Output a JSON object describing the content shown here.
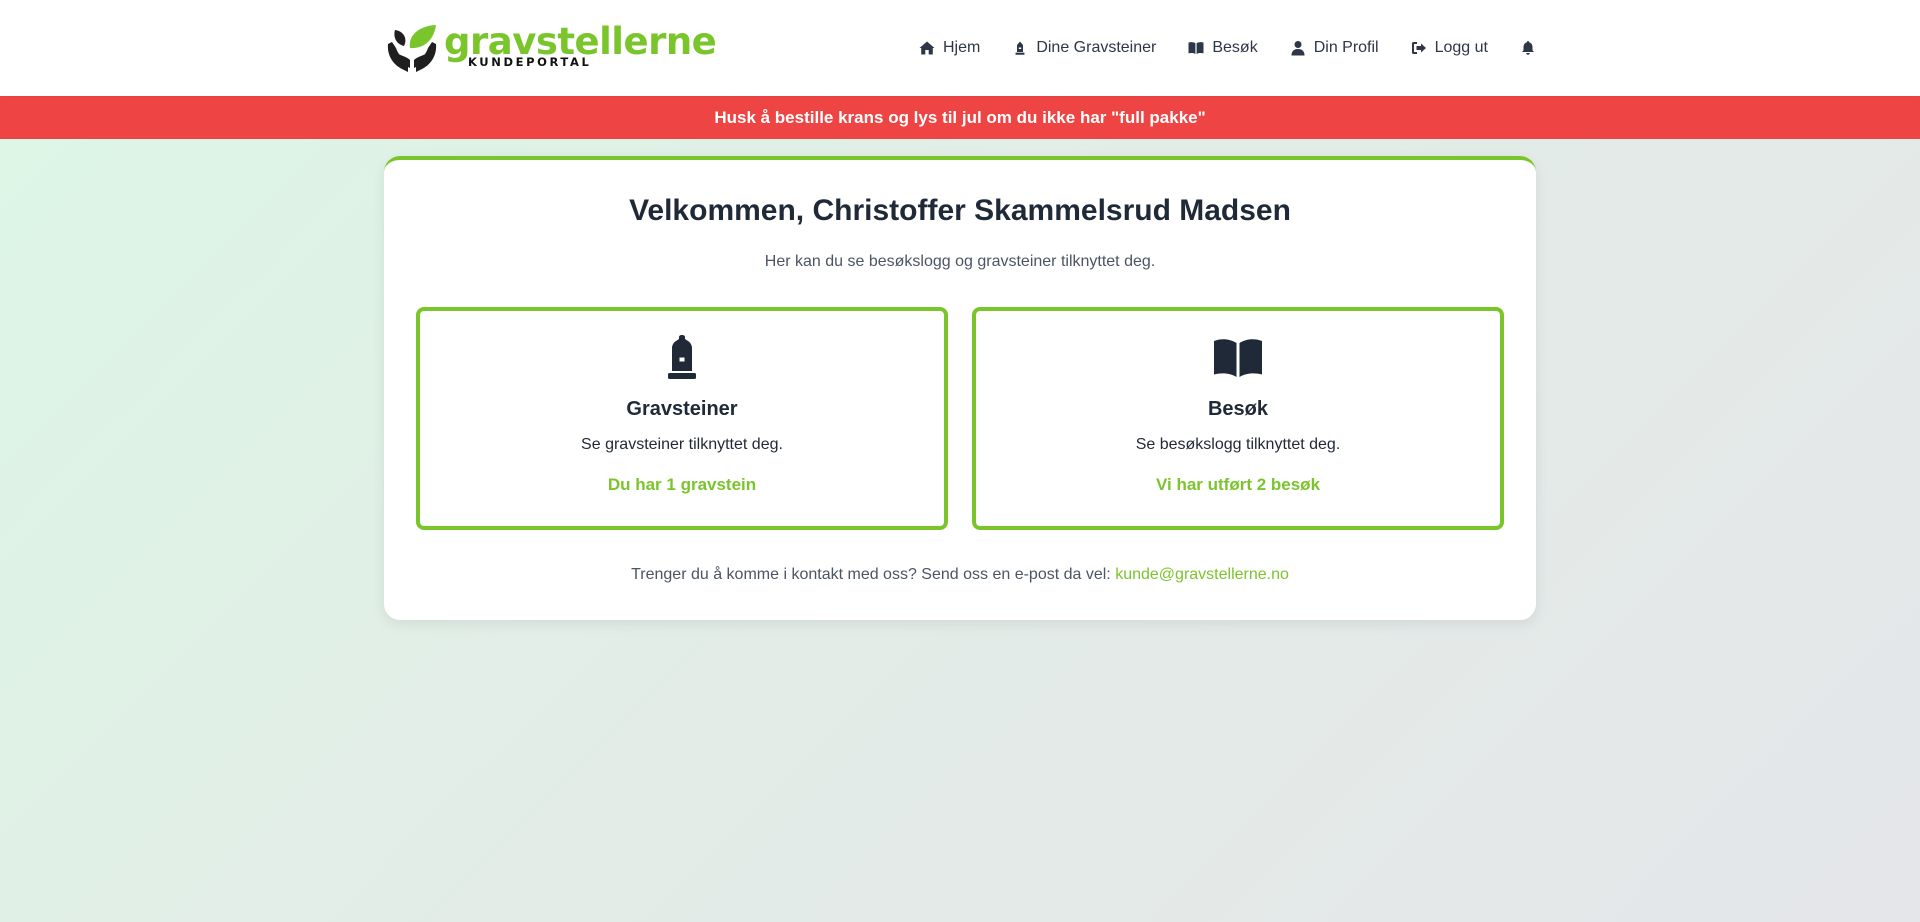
{
  "header": {
    "logo": {
      "word": "gravstellerne",
      "sub": "KUNDEPORTAL"
    },
    "nav": [
      {
        "label": "Hjem",
        "icon": "home-icon"
      },
      {
        "label": "Dine Gravsteiner",
        "icon": "gravestone-icon"
      },
      {
        "label": "Besøk",
        "icon": "book-icon"
      },
      {
        "label": "Din Profil",
        "icon": "user-icon"
      },
      {
        "label": "Logg ut",
        "icon": "logout-icon"
      }
    ],
    "notifications_icon": "bell-icon"
  },
  "banner": {
    "text": "Husk å bestille krans og lys til jul om du ikke har \"full pakke\""
  },
  "main": {
    "title": "Velkommen, Christoffer Skammelsrud Madsen",
    "subtitle": "Her kan du se besøkslogg og gravsteiner tilknyttet deg.",
    "tiles": [
      {
        "icon": "gravestone-icon",
        "title": "Gravsteiner",
        "description": "Se gravsteiner tilknyttet deg.",
        "count": "Du har 1 gravstein"
      },
      {
        "icon": "book-icon",
        "title": "Besøk",
        "description": "Se besøkslogg tilknyttet deg.",
        "count": "Vi har utført 2 besøk"
      }
    ],
    "contact": {
      "text": "Trenger du å komme i kontakt med oss? Send oss en e-post da vel:",
      "email": "kunde@gravstellerne.no"
    }
  },
  "colors": {
    "accent": "#7ac52c",
    "banner": "#ef4444",
    "text_dark": "#1f2937"
  }
}
